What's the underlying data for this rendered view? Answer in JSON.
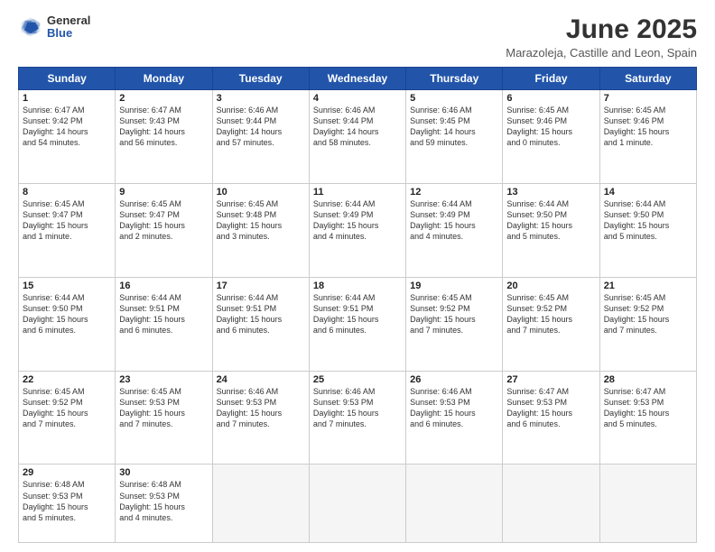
{
  "header": {
    "logo_general": "General",
    "logo_blue": "Blue",
    "title": "June 2025",
    "location": "Marazoleja, Castille and Leon, Spain"
  },
  "weekdays": [
    "Sunday",
    "Monday",
    "Tuesday",
    "Wednesday",
    "Thursday",
    "Friday",
    "Saturday"
  ],
  "weeks": [
    [
      {
        "day": "1",
        "info": "Sunrise: 6:47 AM\nSunset: 9:42 PM\nDaylight: 14 hours\nand 54 minutes."
      },
      {
        "day": "2",
        "info": "Sunrise: 6:47 AM\nSunset: 9:43 PM\nDaylight: 14 hours\nand 56 minutes."
      },
      {
        "day": "3",
        "info": "Sunrise: 6:46 AM\nSunset: 9:44 PM\nDaylight: 14 hours\nand 57 minutes."
      },
      {
        "day": "4",
        "info": "Sunrise: 6:46 AM\nSunset: 9:44 PM\nDaylight: 14 hours\nand 58 minutes."
      },
      {
        "day": "5",
        "info": "Sunrise: 6:46 AM\nSunset: 9:45 PM\nDaylight: 14 hours\nand 59 minutes."
      },
      {
        "day": "6",
        "info": "Sunrise: 6:45 AM\nSunset: 9:46 PM\nDaylight: 15 hours\nand 0 minutes."
      },
      {
        "day": "7",
        "info": "Sunrise: 6:45 AM\nSunset: 9:46 PM\nDaylight: 15 hours\nand 1 minute."
      }
    ],
    [
      {
        "day": "8",
        "info": "Sunrise: 6:45 AM\nSunset: 9:47 PM\nDaylight: 15 hours\nand 1 minute."
      },
      {
        "day": "9",
        "info": "Sunrise: 6:45 AM\nSunset: 9:47 PM\nDaylight: 15 hours\nand 2 minutes."
      },
      {
        "day": "10",
        "info": "Sunrise: 6:45 AM\nSunset: 9:48 PM\nDaylight: 15 hours\nand 3 minutes."
      },
      {
        "day": "11",
        "info": "Sunrise: 6:44 AM\nSunset: 9:49 PM\nDaylight: 15 hours\nand 4 minutes."
      },
      {
        "day": "12",
        "info": "Sunrise: 6:44 AM\nSunset: 9:49 PM\nDaylight: 15 hours\nand 4 minutes."
      },
      {
        "day": "13",
        "info": "Sunrise: 6:44 AM\nSunset: 9:50 PM\nDaylight: 15 hours\nand 5 minutes."
      },
      {
        "day": "14",
        "info": "Sunrise: 6:44 AM\nSunset: 9:50 PM\nDaylight: 15 hours\nand 5 minutes."
      }
    ],
    [
      {
        "day": "15",
        "info": "Sunrise: 6:44 AM\nSunset: 9:50 PM\nDaylight: 15 hours\nand 6 minutes."
      },
      {
        "day": "16",
        "info": "Sunrise: 6:44 AM\nSunset: 9:51 PM\nDaylight: 15 hours\nand 6 minutes."
      },
      {
        "day": "17",
        "info": "Sunrise: 6:44 AM\nSunset: 9:51 PM\nDaylight: 15 hours\nand 6 minutes."
      },
      {
        "day": "18",
        "info": "Sunrise: 6:44 AM\nSunset: 9:51 PM\nDaylight: 15 hours\nand 6 minutes."
      },
      {
        "day": "19",
        "info": "Sunrise: 6:45 AM\nSunset: 9:52 PM\nDaylight: 15 hours\nand 7 minutes."
      },
      {
        "day": "20",
        "info": "Sunrise: 6:45 AM\nSunset: 9:52 PM\nDaylight: 15 hours\nand 7 minutes."
      },
      {
        "day": "21",
        "info": "Sunrise: 6:45 AM\nSunset: 9:52 PM\nDaylight: 15 hours\nand 7 minutes."
      }
    ],
    [
      {
        "day": "22",
        "info": "Sunrise: 6:45 AM\nSunset: 9:52 PM\nDaylight: 15 hours\nand 7 minutes."
      },
      {
        "day": "23",
        "info": "Sunrise: 6:45 AM\nSunset: 9:53 PM\nDaylight: 15 hours\nand 7 minutes."
      },
      {
        "day": "24",
        "info": "Sunrise: 6:46 AM\nSunset: 9:53 PM\nDaylight: 15 hours\nand 7 minutes."
      },
      {
        "day": "25",
        "info": "Sunrise: 6:46 AM\nSunset: 9:53 PM\nDaylight: 15 hours\nand 7 minutes."
      },
      {
        "day": "26",
        "info": "Sunrise: 6:46 AM\nSunset: 9:53 PM\nDaylight: 15 hours\nand 6 minutes."
      },
      {
        "day": "27",
        "info": "Sunrise: 6:47 AM\nSunset: 9:53 PM\nDaylight: 15 hours\nand 6 minutes."
      },
      {
        "day": "28",
        "info": "Sunrise: 6:47 AM\nSunset: 9:53 PM\nDaylight: 15 hours\nand 5 minutes."
      }
    ],
    [
      {
        "day": "29",
        "info": "Sunrise: 6:48 AM\nSunset: 9:53 PM\nDaylight: 15 hours\nand 5 minutes."
      },
      {
        "day": "30",
        "info": "Sunrise: 6:48 AM\nSunset: 9:53 PM\nDaylight: 15 hours\nand 4 minutes."
      },
      null,
      null,
      null,
      null,
      null
    ]
  ]
}
